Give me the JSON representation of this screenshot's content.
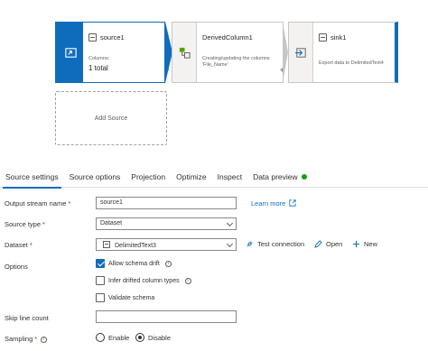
{
  "flow": {
    "source": {
      "title": "source1",
      "columns_label": "Columns:",
      "columns_value": "1 total",
      "plus": "+"
    },
    "derived": {
      "title": "DerivedColumn1",
      "description": "Creating/updating the columns 'File_Name'",
      "plus": "+"
    },
    "sink": {
      "title": "sink1",
      "description": "Export data to DelimitedText4",
      "plus": "+"
    },
    "add_source": "Add Source",
    "accent": "#0f6cbd"
  },
  "tabs": [
    {
      "label": "Source settings",
      "active": true
    },
    {
      "label": "Source options",
      "active": false
    },
    {
      "label": "Projection",
      "active": false
    },
    {
      "label": "Optimize",
      "active": false
    },
    {
      "label": "Inspect",
      "active": false
    },
    {
      "label": "Data preview",
      "active": false,
      "status_color": "#13a10e"
    }
  ],
  "form": {
    "output_stream": {
      "label": "Output stream name",
      "required": "*",
      "value": "source1",
      "link": "Learn more"
    },
    "source_type": {
      "label": "Source type",
      "required": "*",
      "value": "Dataset"
    },
    "dataset": {
      "label": "Dataset",
      "required": "*",
      "value": "DelimitedText3",
      "test_connection": "Test connection",
      "open": "Open",
      "new": "New"
    },
    "options": {
      "label": "Options",
      "allow_schema_drift": {
        "label": "Allow schema drift",
        "checked": true
      },
      "infer_types": {
        "label": "Infer drifted column types",
        "checked": false
      },
      "validate_schema": {
        "label": "Validate schema",
        "checked": false
      }
    },
    "skip_line_count": {
      "label": "Skip line count",
      "value": ""
    },
    "sampling": {
      "label": "Sampling",
      "required": "*",
      "enable": "Enable",
      "disable": "Disable",
      "selected": "Disable"
    }
  }
}
